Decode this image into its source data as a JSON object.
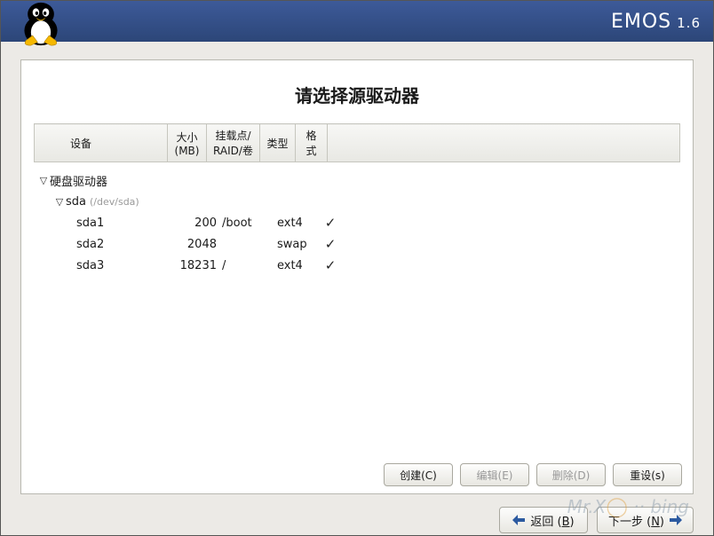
{
  "brand": {
    "name": "EMOS",
    "version": "1.6"
  },
  "title": "请选择源驱动器",
  "columns": {
    "device": "设备",
    "size": "大小\n(MB)",
    "mount": "挂载点/\nRAID/卷",
    "type": "类型",
    "format": "格式"
  },
  "tree": {
    "root_label": "硬盘驱动器",
    "disk": {
      "name": "sda",
      "path": "(/dev/sda)"
    },
    "partitions": [
      {
        "name": "sda1",
        "size": "200",
        "mount": "/boot",
        "type": "ext4",
        "format": true
      },
      {
        "name": "sda2",
        "size": "2048",
        "mount": "",
        "type": "swap",
        "format": true
      },
      {
        "name": "sda3",
        "size": "18231",
        "mount": "/",
        "type": "ext4",
        "format": true
      }
    ]
  },
  "buttons": {
    "create": "创建(C)",
    "edit": "编辑(E)",
    "delete": "删除(D)",
    "reset": "重设(s)",
    "back_label": "返回 (",
    "back_key": "B",
    "next_label": "下一步 (",
    "next_key": "N"
  }
}
